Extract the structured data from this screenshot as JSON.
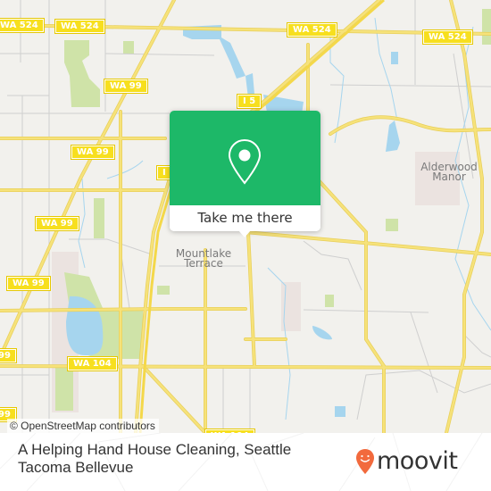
{
  "map": {
    "road_labels": [
      {
        "id": "wa524-left-edge",
        "text": "WA 524"
      },
      {
        "id": "wa524-a",
        "text": "WA 524"
      },
      {
        "id": "wa524-b",
        "text": "WA 524"
      },
      {
        "id": "wa524-c",
        "text": "WA 524"
      },
      {
        "id": "wa524-d",
        "text": "WA 524"
      },
      {
        "id": "wa99-a",
        "text": "WA 99"
      },
      {
        "id": "wa99-b",
        "text": "WA 99"
      },
      {
        "id": "wa99-c",
        "text": "WA 99"
      },
      {
        "id": "wa99-d",
        "text": "WA 99"
      },
      {
        "id": "wa99-e",
        "text": "WA 99"
      },
      {
        "id": "wa99-f",
        "text": "99"
      },
      {
        "id": "wa99-g",
        "text": "99"
      },
      {
        "id": "i5-a",
        "text": "I 5"
      },
      {
        "id": "i5-b",
        "text": "I"
      },
      {
        "id": "wa104-a",
        "text": "WA 104"
      },
      {
        "id": "wa104-b",
        "text": "WA 104"
      }
    ],
    "place_labels": [
      {
        "id": "mountlake-terrace",
        "text": "Mountlake\nTerrace",
        "line1": "Mountlake",
        "line2": "Terrace"
      },
      {
        "id": "alderwood-manor",
        "text": "Alderwood\nManor",
        "line1": "Alderwood",
        "line2": "Manor"
      }
    ],
    "attribution": "© OpenStreetMap contributors",
    "colors": {
      "background": "#f2f1ed",
      "road": "#f6e27a",
      "road_outline": "#e8cf5a",
      "minor_road": "#cfcfcf",
      "water": "#a6d5ee",
      "park": "#cfe3a8",
      "urban": "#ebe3e0"
    }
  },
  "popup": {
    "icon": "map-pin-icon",
    "button_label": "Take me there",
    "color": "#1db868"
  },
  "footer": {
    "title": "A Helping Hand House Cleaning, Seattle Tacoma Bellevue",
    "brand": "moovit",
    "brand_color": "#f26a3d"
  }
}
